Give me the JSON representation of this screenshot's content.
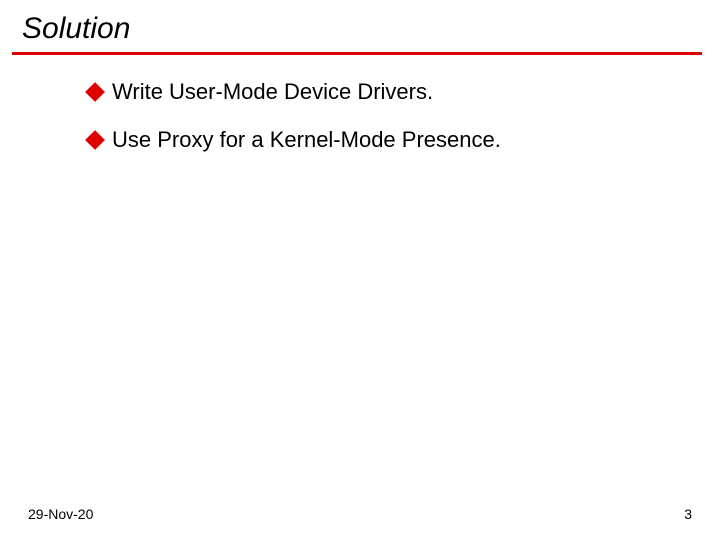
{
  "title": "Solution",
  "bullets": [
    {
      "text": "Write User-Mode Device Drivers."
    },
    {
      "text": "Use Proxy for a Kernel-Mode Presence."
    }
  ],
  "footer": {
    "date": "29-Nov-20",
    "page": "3"
  },
  "accent_color": "#e00000"
}
